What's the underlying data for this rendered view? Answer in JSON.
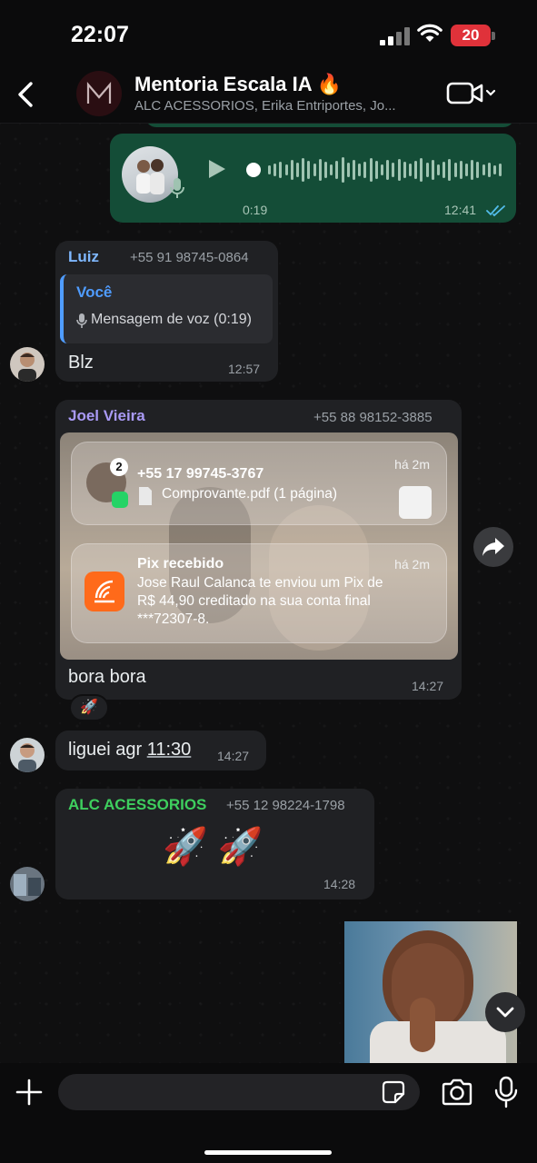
{
  "status_bar": {
    "time": "22:07",
    "battery": "20"
  },
  "header": {
    "title": "Mentoria Escala IA 🔥",
    "participants": "ALC ACESSORIOS, Erika Entriportes, Jo..."
  },
  "messages": {
    "voice": {
      "duration": "0:19",
      "time": "12:41"
    },
    "luiz": {
      "sender": "Luiz",
      "phone": "+55 91 98745-0864",
      "quote_author": "Você",
      "quote_text": "Mensagem de voz (0:19)",
      "text": "Blz",
      "time": "12:57"
    },
    "joel": {
      "sender": "Joel Vieira",
      "phone": "+55 88 98152-3885",
      "notif1": {
        "badge": "2",
        "title": "+55 17 99745-3767",
        "body": "Comprovante.pdf (1 página)",
        "when": "há 2m"
      },
      "notif2": {
        "title": "Pix recebido",
        "line1": "Jose Raul Calanca te enviou um Pix de",
        "line2": "R$ 44,90 creditado na sua conta final",
        "line3": "***72307-8.",
        "when": "há 2m"
      },
      "caption": "bora bora",
      "time": "14:27",
      "reaction": "🚀"
    },
    "liguei": {
      "text_prefix": "liguei agr ",
      "text_link": "11:30",
      "time": "14:27"
    },
    "alc": {
      "sender": "ALC ACESSORIOS",
      "phone": "+55 12 98224-1798",
      "emoji": "🚀 🚀",
      "time": "14:28"
    }
  },
  "composer": {
    "placeholder": ""
  },
  "icons": {
    "back": "chevron-left-icon",
    "video": "video-camera-icon",
    "forward": "share-arrow-icon",
    "scroll_down": "chevron-down-icon",
    "plus": "plus-icon",
    "sticker": "sticker-icon",
    "camera": "camera-icon",
    "mic": "microphone-icon"
  },
  "colors": {
    "incoming_bubble": "#202124",
    "outgoing_bubble": "#144d37",
    "read_ticks": "#53bdeb",
    "sender_luiz": "#7fb8ff",
    "sender_joel": "#a99af5",
    "sender_alc": "#3ecf5e",
    "quote_bar": "#4f9cff",
    "battery": "#e0323a"
  }
}
